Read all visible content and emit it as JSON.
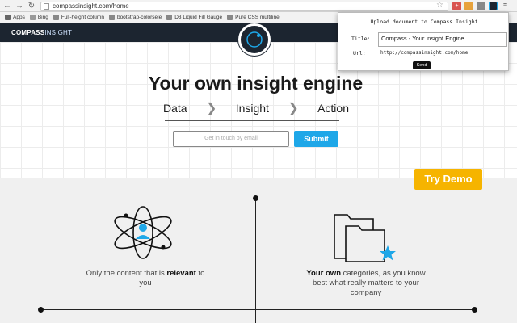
{
  "browser": {
    "url": "compassinsight.com/home",
    "bookmarks": [
      "Apps",
      "Bing",
      "Full-height column",
      "bootstrap-colorsele",
      "D3 Liquid Fill Gauge",
      "Pure CSS multiline"
    ]
  },
  "site": {
    "logo_bold": "COMPASS",
    "logo_thin": "INSIGHT",
    "hero_title": "Your own insight engine",
    "steps": [
      "Data",
      "Insight",
      "Action"
    ],
    "email_placeholder": "Get in touch by email",
    "submit_label": "Submit",
    "try_demo_label": "Try Demo",
    "feature_left": {
      "pre": "Only the content that is ",
      "bold": "relevant",
      "post": " to you"
    },
    "feature_right": {
      "bold": "Your own",
      "post": " categories, as you know best what really matters to your company"
    }
  },
  "popup": {
    "title": "Upload document to Compass Insight",
    "title_label": "Title:",
    "title_value": "Compass - Your insight Engine",
    "url_label": "Url:",
    "url_value": "http://compassinsight.com/home",
    "send_label": "Send"
  },
  "colors": {
    "header": "#1c2530",
    "accent_blue": "#1ea7e8",
    "demo_yellow": "#f6b400"
  }
}
